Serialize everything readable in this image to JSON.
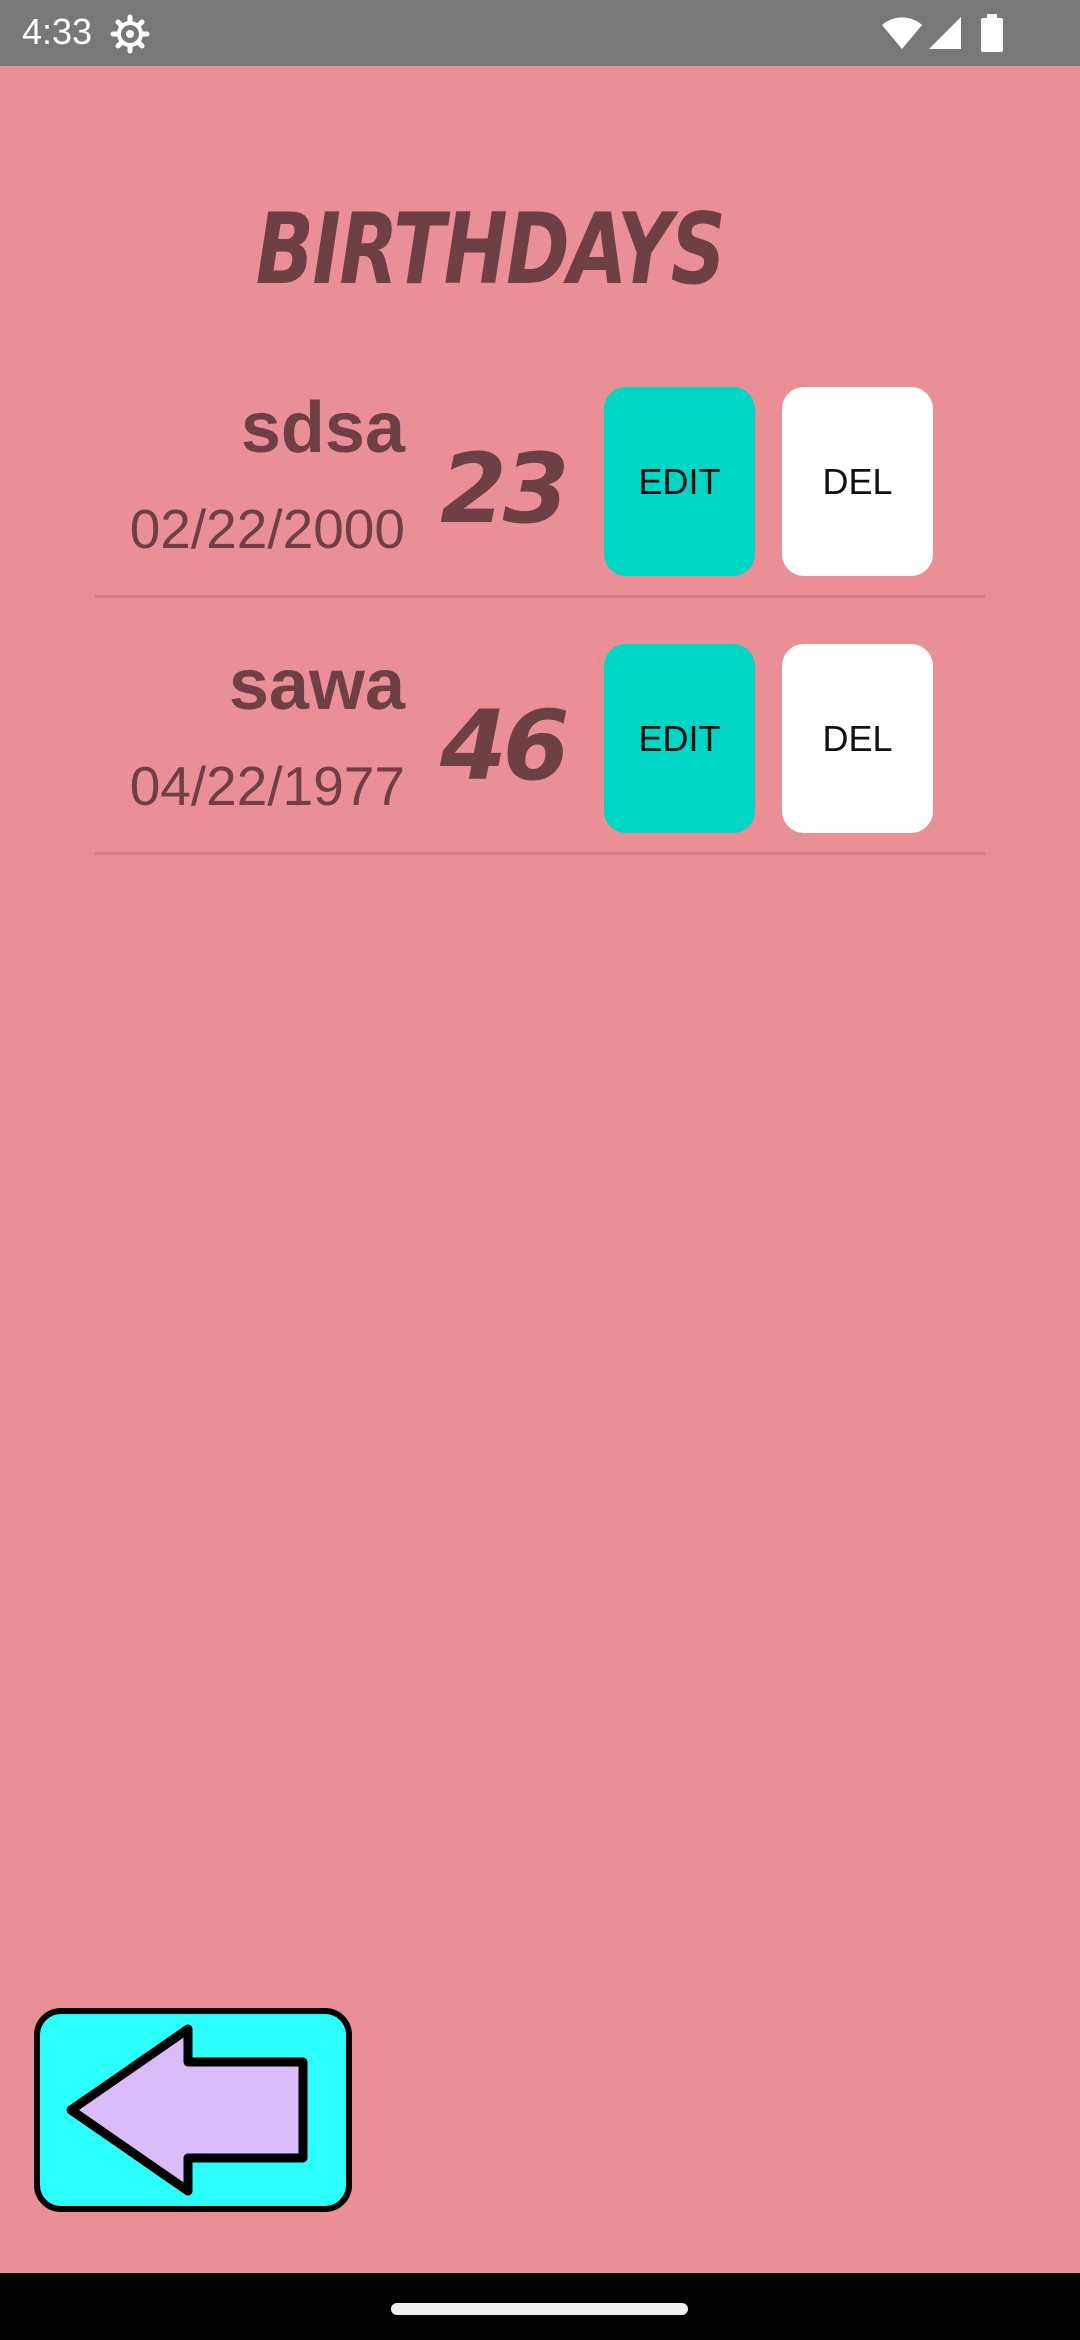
{
  "status_bar": {
    "time": "4:33",
    "icons": [
      "gear-icon",
      "wifi-icon",
      "cell-signal-icon",
      "battery-icon"
    ]
  },
  "title": "BIRTHDAYS",
  "birthdays": [
    {
      "name": "sdsa",
      "date": "02/22/2000",
      "age": "23",
      "edit_label": "EDIT",
      "delete_label": "DEL"
    },
    {
      "name": "sawa",
      "date": "04/22/1977",
      "age": "46",
      "edit_label": "EDIT",
      "delete_label": "DEL"
    }
  ],
  "back_button": {
    "icon": "left-arrow-icon"
  },
  "colors": {
    "background": "#ea8f96",
    "text": "#6e3f44",
    "edit_button": "#00d6c5",
    "delete_button": "#ffffff",
    "back_button_fill": "#2cfdfd",
    "back_arrow_fill": "#dbbcfb"
  }
}
